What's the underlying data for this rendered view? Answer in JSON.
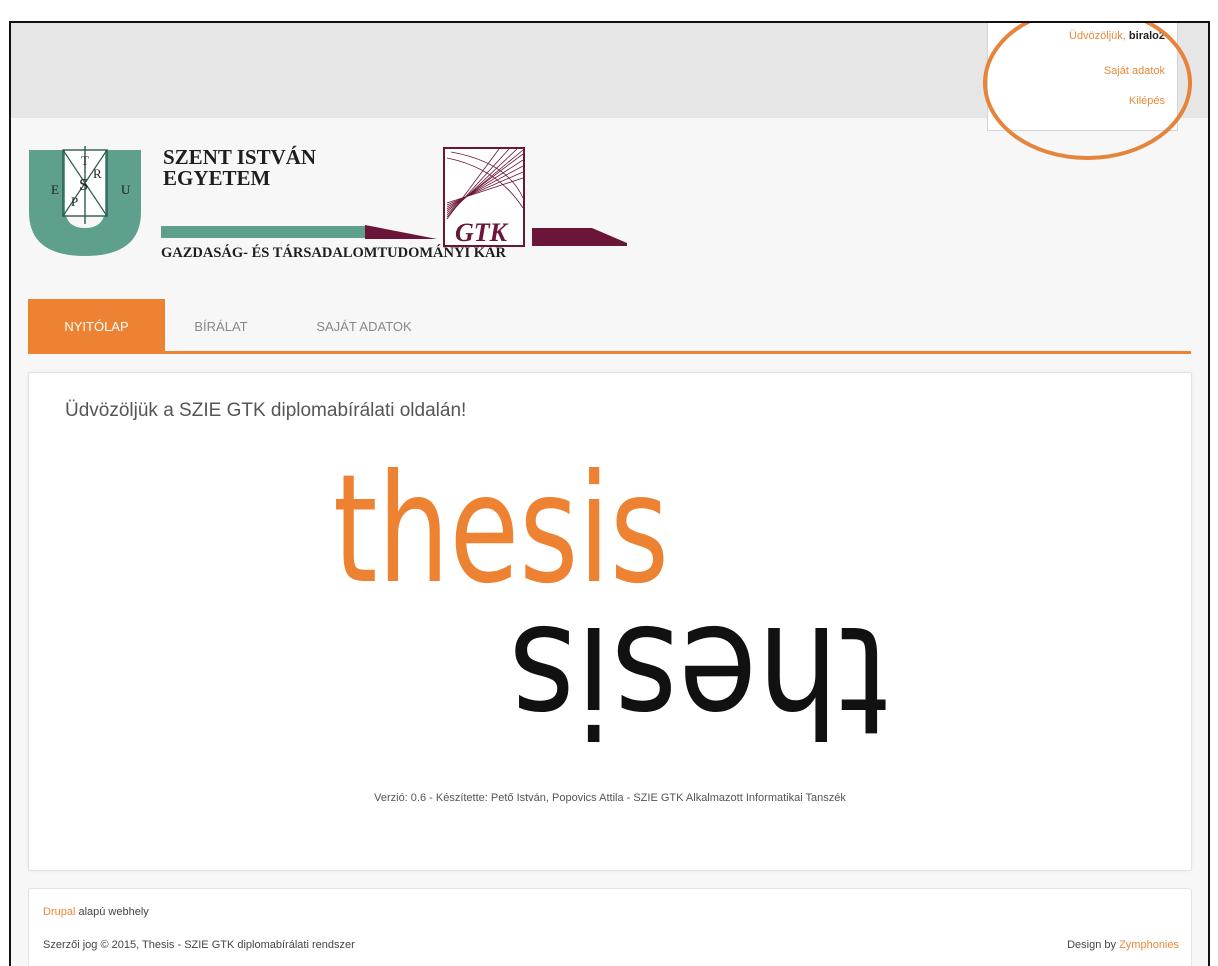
{
  "user_menu": {
    "welcome_label": "Üdvözöljük,",
    "username": "biralo2",
    "own_data_link": "Saját adatok",
    "logout_link": "Kilépés"
  },
  "branding": {
    "university_line1": "SZENT ISTVÁN",
    "university_line2": "EGYETEM",
    "faculty": "GAZDASÁG- ÉS TÁRSADALOMTUDOMÁNYI KAR",
    "gtk_label": "GTK",
    "seal_letters": [
      "T",
      "R",
      "S",
      "P",
      "E",
      "U"
    ]
  },
  "nav": {
    "tabs": [
      {
        "label": "NYITÓLAP",
        "active": true
      },
      {
        "label": "BÍRÁLAT",
        "active": false
      },
      {
        "label": "SAJÁT ADATOK",
        "active": false
      }
    ]
  },
  "main": {
    "heading": "Üdvözöljük a SZIE GTK diplomabírálati oldalán!",
    "logo_text_top": "thesis",
    "logo_text_bottom": "thesis",
    "version": "Verzió: 0.6 - Készítette: Pető István, Popovics Attila - SZIE GTK Alkalmazott Informatikai Tanszék"
  },
  "footer": {
    "drupal_link": "Drupal",
    "drupal_suffix": " alapú webhely",
    "copyright": "Szerzői jog © 2015, Thesis - SZIE GTK diplomabírálati rendszer",
    "design_prefix": "Design by ",
    "design_link": "Zymphonies"
  },
  "colors": {
    "accent": "#ee8233",
    "link": "#e8893a",
    "logo_teal": "#5e9f8d",
    "logo_maroon": "#6b1538",
    "highlight_circle": "#e6843b"
  }
}
